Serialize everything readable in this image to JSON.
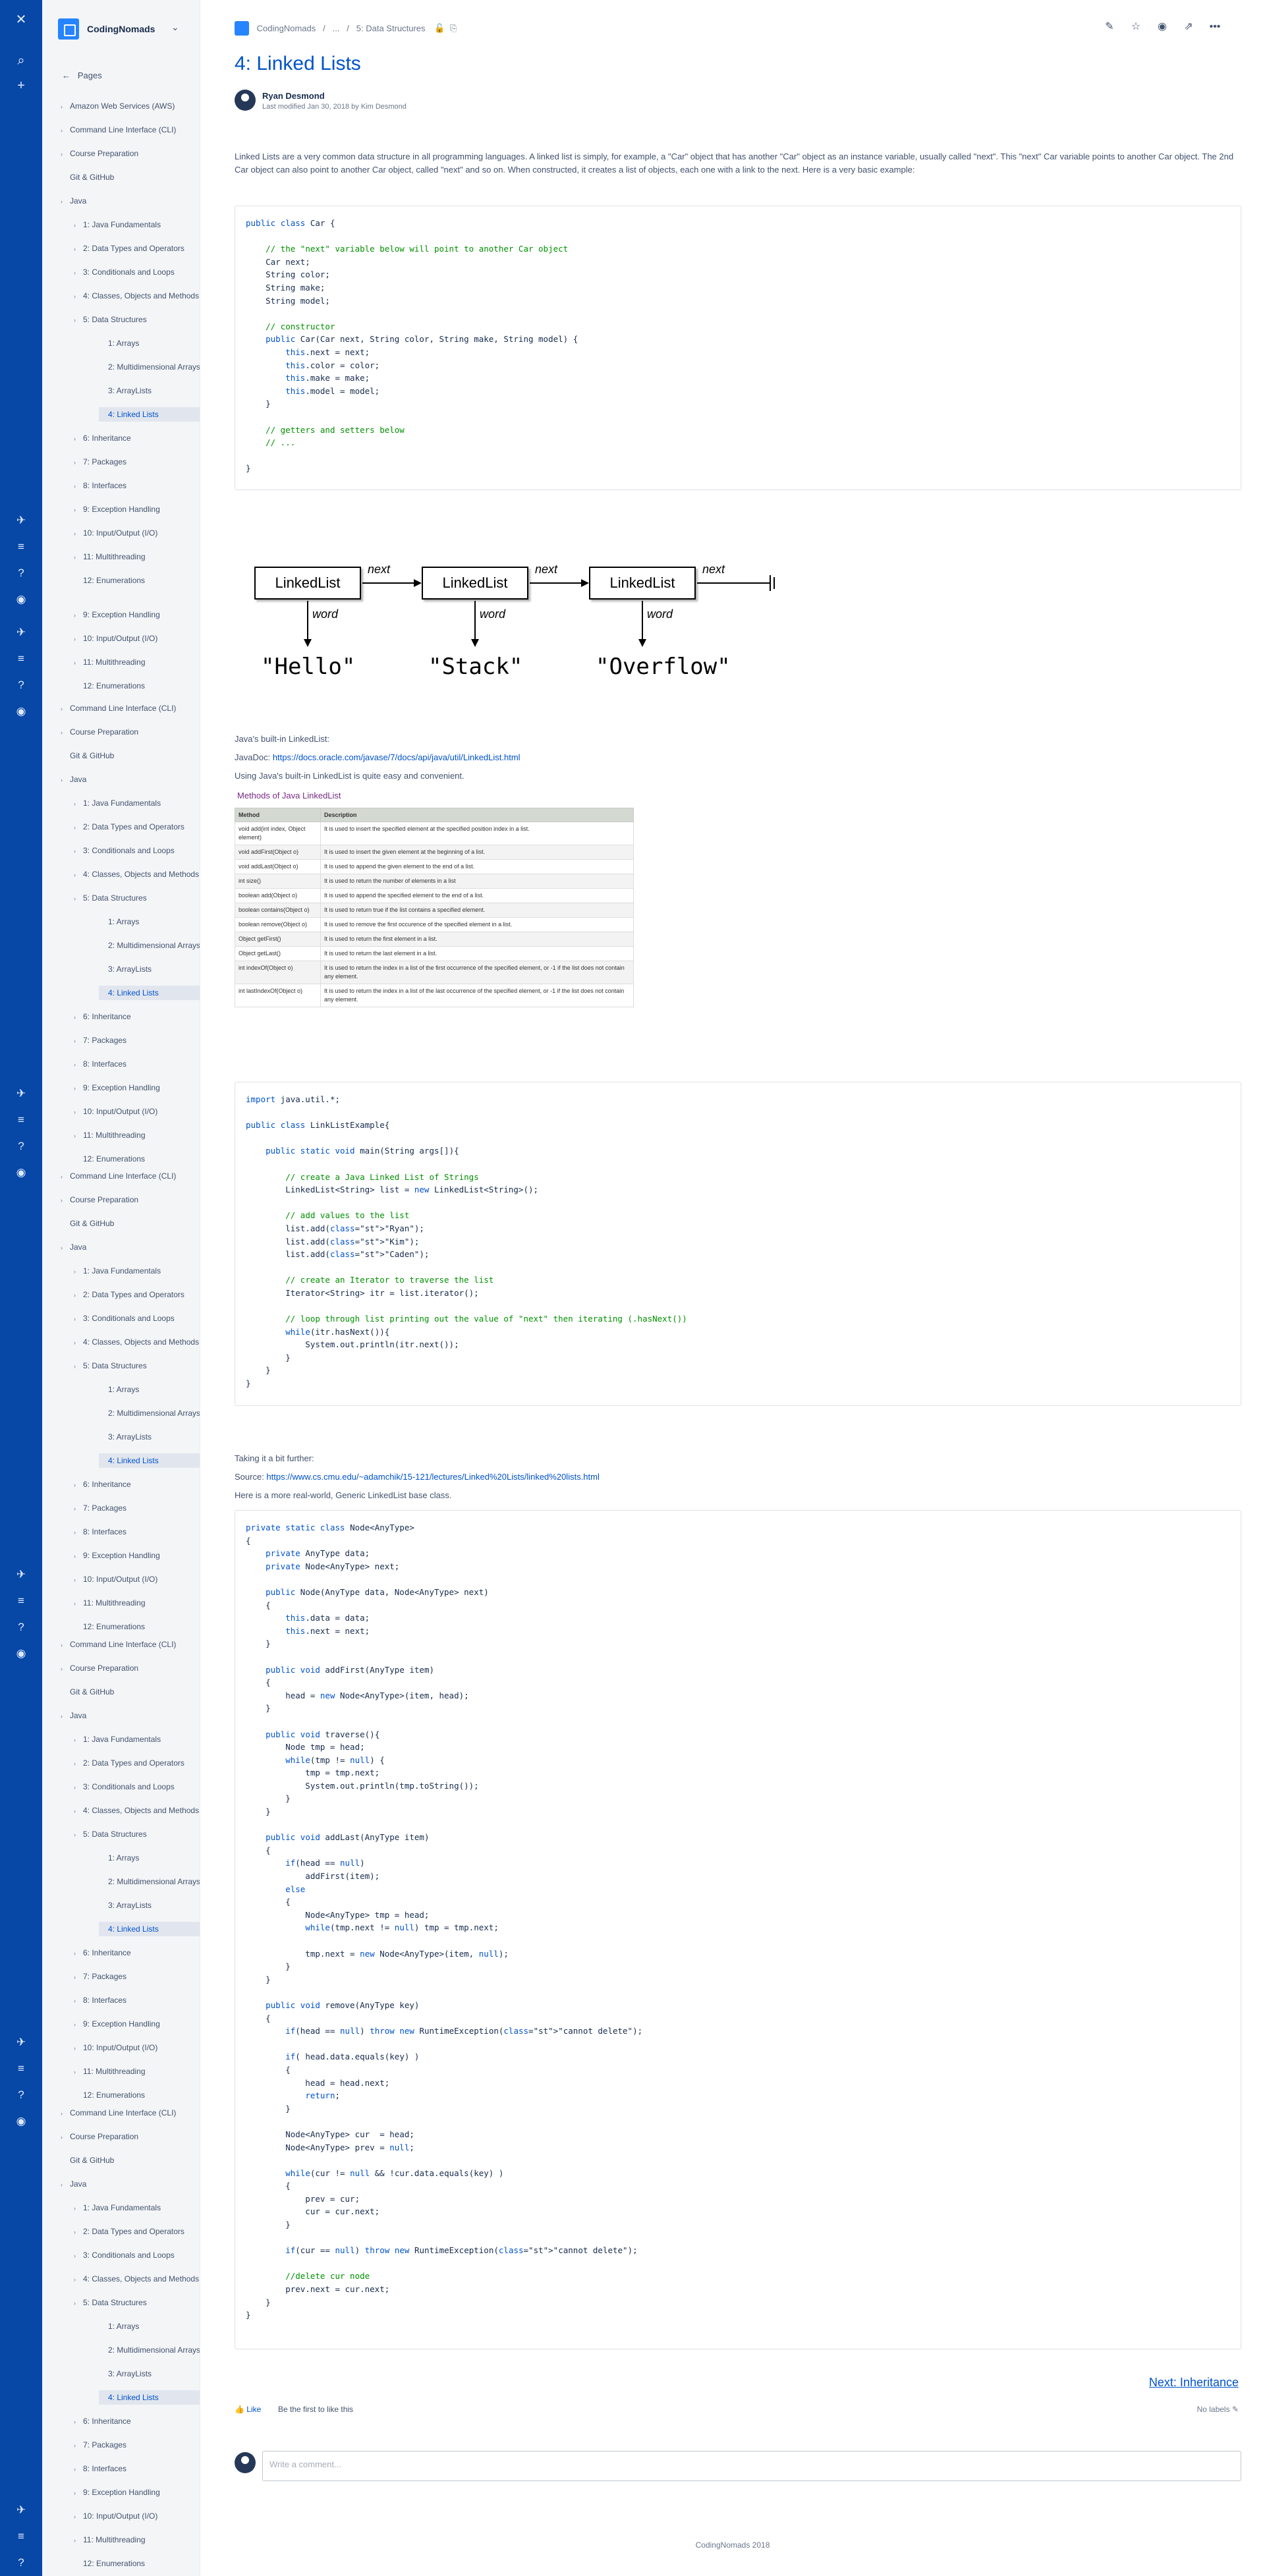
{
  "global_nav": {
    "logo": "confluence-logo-icon",
    "search": "search-icon",
    "create": "plus-icon"
  },
  "sidebar": {
    "space_name": "CodingNomads",
    "pages_label": "Pages",
    "top_items": [
      "Amazon Web Services (AWS)",
      "Command Line Interface (CLI)",
      "Course Preparation",
      "Git & GitHub",
      "Java"
    ],
    "java_items": [
      "1: Java Fundamentals",
      "2: Data Types and Operators",
      "3: Conditionals and Loops",
      "4: Classes, Objects and Methods",
      "5: Data Structures"
    ],
    "ds_items": [
      "1: Arrays",
      "2: Multidimensional Arrays",
      "3: ArrayLists",
      "4: Linked Lists"
    ],
    "after_items": [
      "6: Inheritance",
      "7: Packages",
      "8: Interfaces",
      "9: Exception Handling",
      "10: Input/Output (I/O)",
      "11: Multithreading",
      "12: Enumerations"
    ],
    "repeat_items": [
      "Command Line Interface (CLI)",
      "Course Preparation",
      "Git & GitHub",
      "Java"
    ]
  },
  "breadcrumb": {
    "space": "CodingNomads",
    "ellipsis": "...",
    "parent": "5: Data Structures",
    "sep": "/"
  },
  "page": {
    "title": "4: Linked Lists",
    "author": "Ryan Desmond",
    "modified": "Last modified Jan 30, 2018 by Kim Desmond",
    "intro": "Linked Lists are a very common data structure in all programming languages. A linked list is simply, for example, a \"Car\" object that has another \"Car\" object as an instance variable, usually called \"next\". This \"next\" Car variable points to another Car object. The 2nd Car object can also point to another Car object, called \"next\" and so on. When constructed, it creates a list of objects, each one with a link to the next. Here is a very basic example:",
    "builtin_heading": "Java's built-in LinkedList:",
    "javadoc_label": "JavaDoc: ",
    "javadoc_url": "https://docs.oracle.com/javase/7/docs/api/java/util/LinkedList.html",
    "builtin_text": "Using Java's built-in LinkedList is quite easy and convenient.",
    "further_heading": "Taking it a bit further:",
    "source_label": "Source: ",
    "source_url": "https://www.cs.cmu.edu/~adamchik/15-121/lectures/Linked%20Lists/linked%20lists.html",
    "further_text": "Here is a more real-world, Generic LinkedList base class.",
    "next_link": "Next: Inheritance",
    "like": "Like",
    "like_text": "Be the first to like this",
    "labels": "No labels",
    "comment_placeholder": "Write a comment...",
    "footer": "CodingNomads 2018"
  },
  "diagram": {
    "node_label": "LinkedList",
    "next_label": "next",
    "word_label": "word",
    "words": [
      "\"Hello\"",
      "\"Stack\"",
      "\"Overflow\""
    ]
  },
  "methods_table": {
    "title": "Methods of Java LinkedList",
    "headers": [
      "Method",
      "Description"
    ],
    "rows": [
      [
        "void add(int index, Object element)",
        "It is used to insert the specified element at the specified position index in a list."
      ],
      [
        "void addFirst(Object o)",
        "It is used to insert the given element at the beginning of a list."
      ],
      [
        "void addLast(Object o)",
        "It is used to append the given element to the end of a list."
      ],
      [
        "int size()",
        "It is used to return the number of elements in a list"
      ],
      [
        "boolean add(Object o)",
        "It is used to append the specified element to the end of a list."
      ],
      [
        "boolean contains(Object o)",
        "It is used to return true if the list contains a specified element."
      ],
      [
        "boolean remove(Object o)",
        "It is used to remove the first occurence of the specified element in a list."
      ],
      [
        "Object getFirst()",
        "It is used to return the first element in a list."
      ],
      [
        "Object getLast()",
        "It is used to return the last element in a list."
      ],
      [
        "int indexOf(Object o)",
        "It is used to return the index in a list of the first occurrence of the specified element, or -1 if the list does not contain any element."
      ],
      [
        "int lastIndexOf(Object o)",
        "It is used to return the index in a list of the last occurrence of the specified element, or -1 if the list does not contain any element."
      ]
    ]
  },
  "code1": "public class Car {\n\n    // the \"next\" variable below will point to another Car object\n    Car next;\n    String color;\n    String make;\n    String model;\n\n    // constructor\n    public Car(Car next, String color, String make, String model) {\n        this.next = next;\n        this.color = color;\n        this.make = make;\n        this.model = model;\n    }\n\n    // getters and setters below\n    // ...\n\n}",
  "code2": "import java.util.*;\n\npublic class LinkListExample{\n\n    public static void main(String args[]){\n\n        // create a Java Linked List of Strings\n        LinkedList<String> list = new LinkedList<String>();\n\n        // add values to the list\n        list.add(\"Ryan\");\n        list.add(\"Kim\");\n        list.add(\"Caden\");\n\n        // create an Iterator to traverse the list\n        Iterator<String> itr = list.iterator();\n\n        // loop through list printing out the value of \"next\" then iterating (.hasNext())\n        while(itr.hasNext()){\n            System.out.println(itr.next());\n        }\n    }\n}",
  "code3": "private static class Node<AnyType>\n{\n    private AnyType data;\n    private Node<AnyType> next;\n\n    public Node(AnyType data, Node<AnyType> next)\n    {\n        this.data = data;\n        this.next = next;\n    }\n\n    public void addFirst(AnyType item)\n    {\n        head = new Node<AnyType>(item, head);\n    }\n\n    public void traverse(){\n        Node tmp = head;\n        while(tmp != null) {\n            tmp = tmp.next;\n            System.out.println(tmp.toString());\n        }\n    }\n\n    public void addLast(AnyType item)\n    {\n        if(head == null)\n            addFirst(item);\n        else\n        {\n            Node<AnyType> tmp = head;\n            while(tmp.next != null) tmp = tmp.next;\n\n            tmp.next = new Node<AnyType>(item, null);\n        }\n    }\n\n    public void remove(AnyType key)\n    {\n        if(head == null) throw new RuntimeException(\"cannot delete\");\n\n        if( head.data.equals(key) )\n        {\n            head = head.next;\n            return;\n        }\n\n        Node<AnyType> cur  = head;\n        Node<AnyType> prev = null;\n\n        while(cur != null && !cur.data.equals(key) )\n        {\n            prev = cur;\n            cur = cur.next;\n        }\n\n        if(cur == null) throw new RuntimeException(\"cannot delete\");\n\n        //delete cur node\n        prev.next = cur.next;\n    }\n}"
}
